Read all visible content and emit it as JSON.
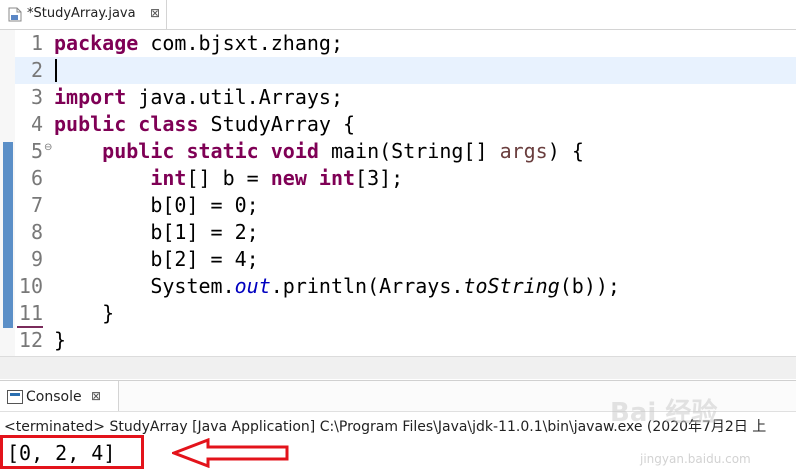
{
  "editor_tab": {
    "title": "*StudyArray.java",
    "close": "⊠"
  },
  "code_lines": [
    {
      "num": "1",
      "parts": [
        {
          "t": "package",
          "c": "kw"
        },
        {
          "t": " com.bjsxt.zhang;",
          "c": ""
        }
      ]
    },
    {
      "num": "2",
      "parts": []
    },
    {
      "num": "3",
      "parts": [
        {
          "t": "import",
          "c": "kw"
        },
        {
          "t": " java.util.Arrays;",
          "c": ""
        }
      ]
    },
    {
      "num": "4",
      "parts": [
        {
          "t": "public",
          "c": "kw"
        },
        {
          "t": " ",
          "c": ""
        },
        {
          "t": "class",
          "c": "kw"
        },
        {
          "t": " StudyArray {",
          "c": ""
        }
      ]
    },
    {
      "num": "5",
      "fold": "⊖",
      "parts": [
        {
          "t": "    ",
          "c": ""
        },
        {
          "t": "public",
          "c": "kw"
        },
        {
          "t": " ",
          "c": ""
        },
        {
          "t": "static",
          "c": "kw"
        },
        {
          "t": " ",
          "c": ""
        },
        {
          "t": "void",
          "c": "kw"
        },
        {
          "t": " main(String[] ",
          "c": ""
        },
        {
          "t": "args",
          "c": "var"
        },
        {
          "t": ") {",
          "c": ""
        }
      ]
    },
    {
      "num": "6",
      "parts": [
        {
          "t": "        ",
          "c": ""
        },
        {
          "t": "int",
          "c": "kw"
        },
        {
          "t": "[] b = ",
          "c": ""
        },
        {
          "t": "new",
          "c": "kw"
        },
        {
          "t": " ",
          "c": ""
        },
        {
          "t": "int",
          "c": "kw"
        },
        {
          "t": "[3];",
          "c": ""
        }
      ]
    },
    {
      "num": "7",
      "parts": [
        {
          "t": "        b[0] = 0;",
          "c": ""
        }
      ]
    },
    {
      "num": "8",
      "parts": [
        {
          "t": "        b[1] = 2;",
          "c": ""
        }
      ]
    },
    {
      "num": "9",
      "parts": [
        {
          "t": "        b[2] = 4;",
          "c": ""
        }
      ]
    },
    {
      "num": "10",
      "parts": [
        {
          "t": "        System.",
          "c": ""
        },
        {
          "t": "out",
          "c": "field"
        },
        {
          "t": ".println(Arrays.",
          "c": ""
        },
        {
          "t": "toString",
          "c": "meth"
        },
        {
          "t": "(b));",
          "c": ""
        }
      ]
    },
    {
      "num": "11",
      "parts": [
        {
          "t": "    }",
          "c": ""
        }
      ]
    },
    {
      "num": "12",
      "parts": [
        {
          "t": "}",
          "c": ""
        }
      ]
    }
  ],
  "console": {
    "tab_label": "Console",
    "close": "⊠",
    "status": "<terminated> StudyArray [Java Application] C:\\Program Files\\Java\\jdk-11.0.1\\bin\\javaw.exe  (2020年7月2日 上",
    "output": "[0, 2, 4]"
  },
  "annotation_color": "#e3131b",
  "watermark": {
    "text": "Bai 经验",
    "sub": "jingyan.baidu.com"
  }
}
